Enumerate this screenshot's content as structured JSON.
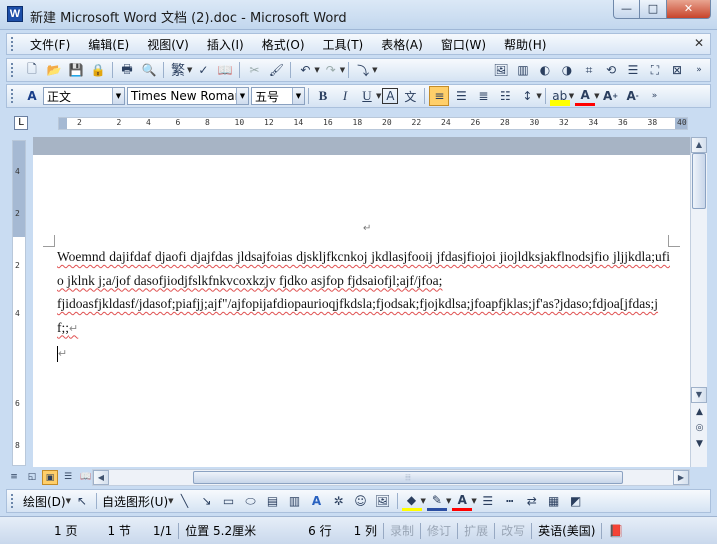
{
  "window": {
    "title": "新建 Microsoft Word 文档 (2).doc - Microsoft Word",
    "app_icon": "W",
    "controls": {
      "minimize": "—",
      "maximize": "□",
      "close": "✕"
    }
  },
  "menubar": {
    "items": [
      "文件(F)",
      "编辑(E)",
      "视图(V)",
      "插入(I)",
      "格式(O)",
      "工具(T)",
      "表格(A)",
      "窗口(W)",
      "帮助(H)"
    ],
    "close_label": "✕"
  },
  "format_toolbar": {
    "style_value": "正文",
    "font_value": "Times New Roman",
    "size_value": "五号",
    "bold": "B",
    "italic": "I",
    "underline": "U",
    "char_border": "A",
    "special": "文"
  },
  "standard_toolbar": {
    "traditional": "繁"
  },
  "ruler": {
    "h_ticks": [
      "2",
      "2",
      "4",
      "6",
      "8",
      "10",
      "12",
      "14",
      "16",
      "18",
      "20",
      "22",
      "24",
      "26",
      "28",
      "30",
      "32",
      "34",
      "36",
      "38",
      "40"
    ],
    "v_ticks": [
      "4",
      "2",
      "2",
      "4",
      "6",
      "8"
    ]
  },
  "document": {
    "paragraphs": [
      "Woemnd dajifdaf djaofi djajfdas jldsajfoias djskljfkcnkoj jkdlasjfooij jfdasjfiojoi jiojldksjakflnodsjfio jljjkdla;ufio jklnk j;a/jof dasofjiodjfslkfnkvcoxkzjv fjdko asjfop fjdsaiofjl;ajf/jfoa;",
      "fjidoasfjkldasf/jdasof;piafjj;ajf\"/ajfopijafdiopaurioqjfkdsla;fjodsak;fjojkdlsa;jfoapfjklas;jf'as?jdaso;fdjoa[jfdas;jf;;"
    ],
    "paragraph_mark": "↵"
  },
  "drawing_toolbar": {
    "draw_label": "绘图(D)",
    "autoshapes_label": "自选图形(U)"
  },
  "statusbar": {
    "page": "1 页",
    "section": "1 节",
    "page_of": "1/1",
    "position": "位置 5.2厘米",
    "line": "6 行",
    "column": "1 列",
    "rec": "录制",
    "trk": "修订",
    "ext": "扩展",
    "ovr": "改写",
    "language": "英语(美国)"
  },
  "colors": {
    "highlight": "#ffff00",
    "font_color": "#ff0000",
    "spell_underline": "#e05050"
  }
}
